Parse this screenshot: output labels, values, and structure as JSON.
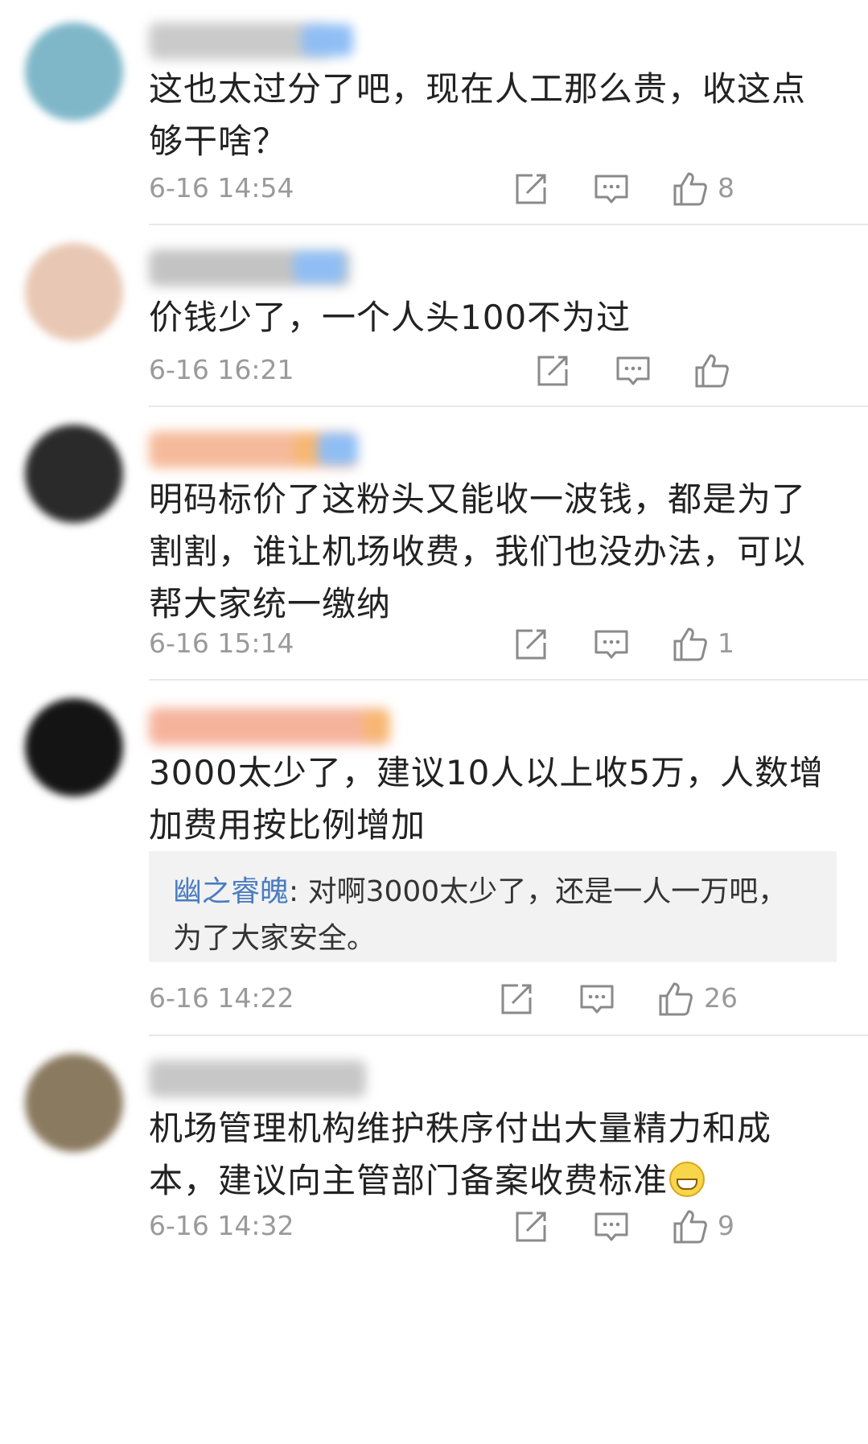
{
  "comments": [
    {
      "text": "这也太过分了吧，现在人工那么贵，收这点够干啥？",
      "time": "6-16 14:54",
      "likes": "8",
      "avatar_color": "#7fb7c9",
      "name_color": "#b9b9b9"
    },
    {
      "text": "价钱少了，一个人头100不为过",
      "time": "6-16 16:21",
      "likes": "",
      "avatar_color": "#e8c8b4",
      "name_color": "#b0b0b0"
    },
    {
      "text": "明码标价了这粉头又能收一波钱，都是为了割割，谁让机场收费，我们也没办法，可以帮大家统一缴纳",
      "time": "6-16 15:14",
      "likes": "1",
      "avatar_color": "#2a2a2a",
      "name_color": "#f2a47a"
    },
    {
      "text": "3000太少了，建议10人以上收5万，人数增加费用按比例增加",
      "reply_name": "幽之睿魄",
      "reply_text": ": 对啊3000太少了，还是一人一万吧，为了大家安全。",
      "time": "6-16 14:22",
      "likes": "26",
      "avatar_color": "#141414",
      "name_color": "#f39a7c"
    },
    {
      "text": "机场管理机构维护秩序付出大量精力和成本，建议向主管部门备案收费标准",
      "time": "6-16 14:32",
      "likes": "9",
      "avatar_color": "#8a7a60",
      "name_color": "#b5b5b5"
    }
  ],
  "icons": {
    "share": "share-icon",
    "comment": "comment-icon",
    "like": "thumbs-up-icon"
  }
}
